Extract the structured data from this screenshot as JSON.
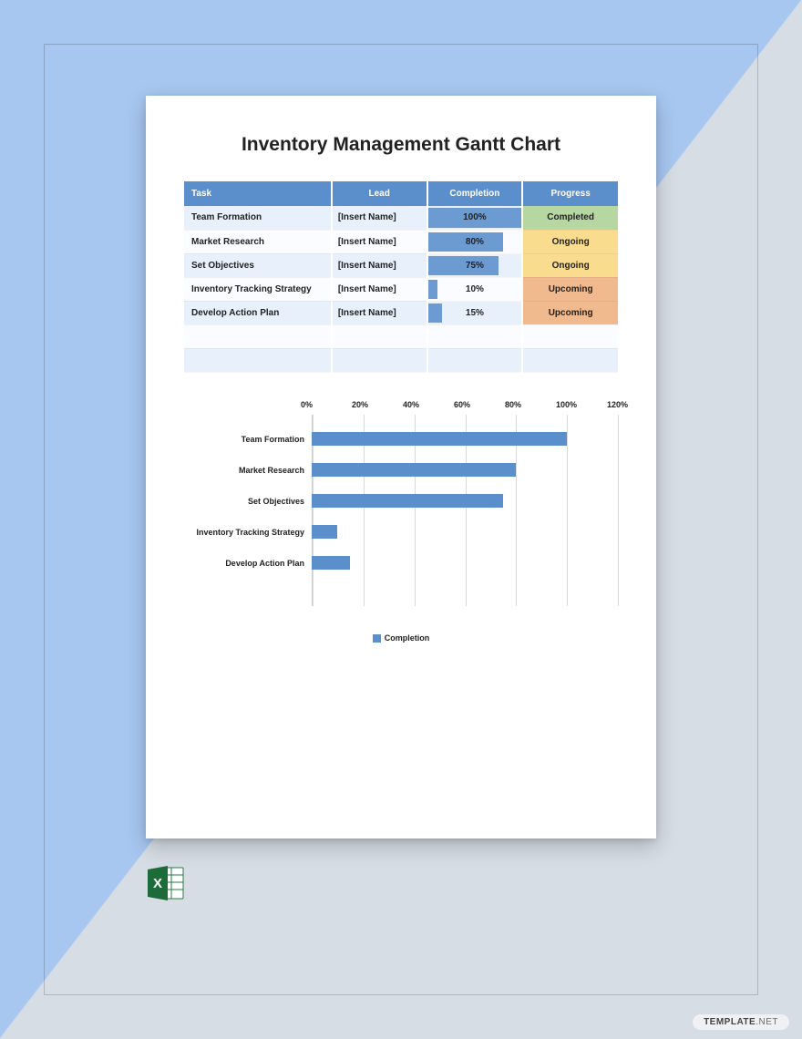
{
  "document": {
    "title": "Inventory Management Gantt Chart"
  },
  "table": {
    "headers": [
      "Task",
      "Lead",
      "Completion",
      "Progress"
    ],
    "rows": [
      {
        "task": "Team Formation",
        "lead": "[Insert Name]",
        "completion": 100,
        "completion_label": "100%",
        "progress": "Completed",
        "progress_class": "prog-completed",
        "row_class": "row-alt"
      },
      {
        "task": "Market Research",
        "lead": "[Insert Name]",
        "completion": 80,
        "completion_label": "80%",
        "progress": "Ongoing",
        "progress_class": "prog-ongoing",
        "row_class": "row-norm"
      },
      {
        "task": "Set Objectives",
        "lead": "[Insert Name]",
        "completion": 75,
        "completion_label": "75%",
        "progress": "Ongoing",
        "progress_class": "prog-ongoing",
        "row_class": "row-alt"
      },
      {
        "task": "Inventory Tracking Strategy",
        "lead": "[Insert Name]",
        "completion": 10,
        "completion_label": "10%",
        "progress": "Upcoming",
        "progress_class": "prog-upcoming",
        "row_class": "row-norm"
      },
      {
        "task": "Develop Action Plan",
        "lead": "[Insert Name]",
        "completion": 15,
        "completion_label": "15%",
        "progress": "Upcoming",
        "progress_class": "prog-upcoming",
        "row_class": "row-alt"
      }
    ]
  },
  "chart_data": {
    "type": "bar",
    "orientation": "horizontal",
    "categories": [
      "Team Formation",
      "Market Research",
      "Set Objectives",
      "Inventory Tracking Strategy",
      "Develop Action Plan"
    ],
    "values": [
      100,
      80,
      75,
      10,
      15
    ],
    "title": "",
    "xlabel": "",
    "ylabel": "",
    "xlim": [
      0,
      120
    ],
    "x_ticks": [
      0,
      20,
      40,
      60,
      80,
      100,
      120
    ],
    "x_tick_labels": [
      "0%",
      "20%",
      "40%",
      "60%",
      "80%",
      "100%",
      "120%"
    ],
    "legend": [
      "Completion"
    ],
    "series_color": "#5B8FCB"
  },
  "footer": {
    "icon": "excel-icon",
    "watermark_bold": "TEMPLATE",
    "watermark_light": ".NET"
  }
}
